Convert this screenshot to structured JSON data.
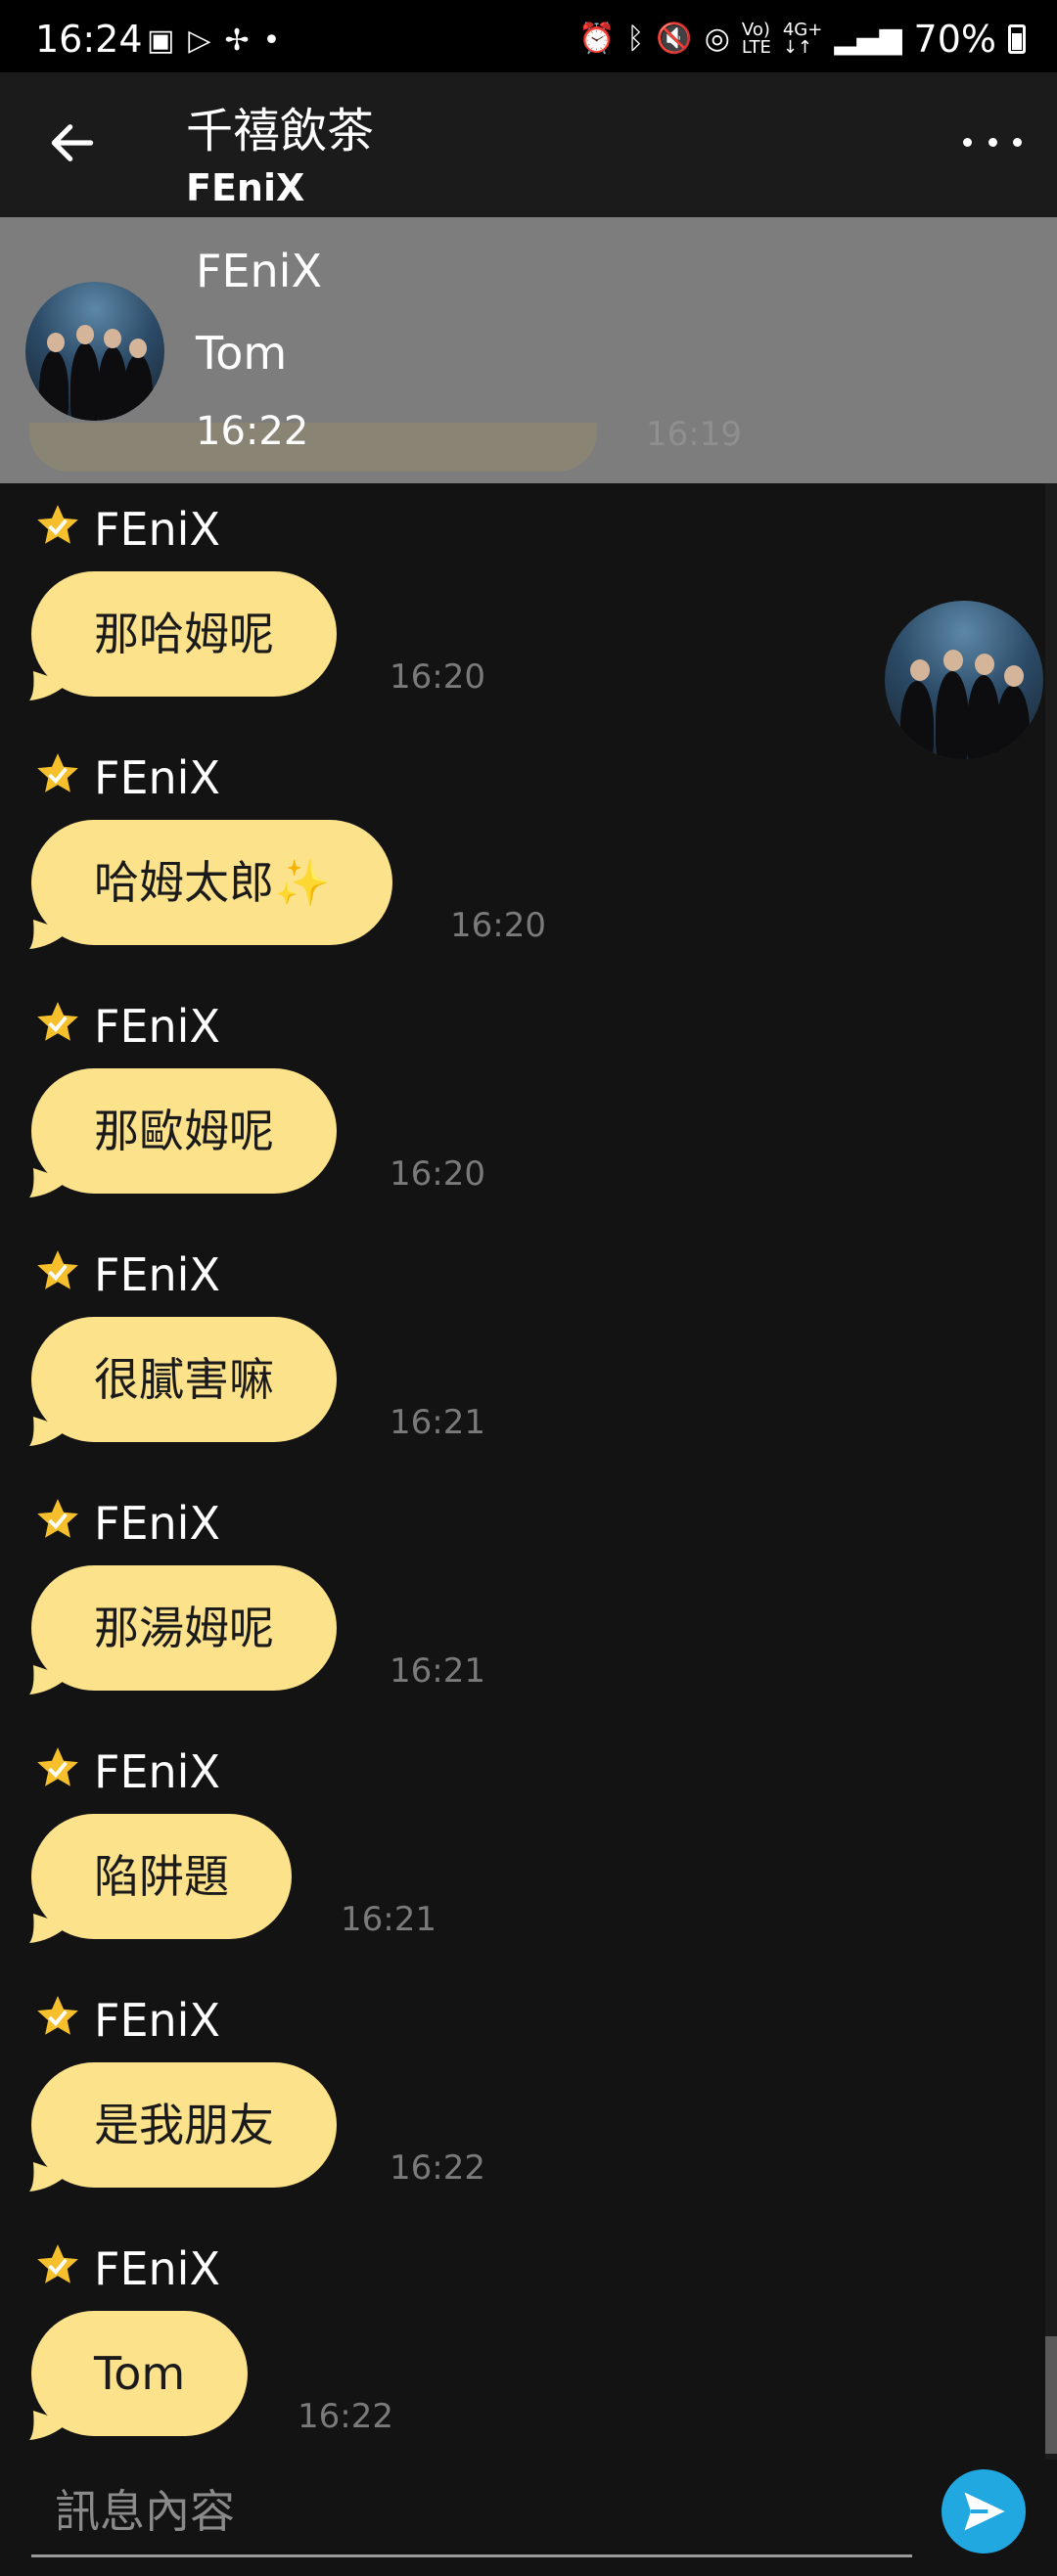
{
  "status_bar": {
    "time": "16:24",
    "battery": "70%",
    "left_icons": [
      "gallery-icon",
      "play-store-icon",
      "fan-icon",
      "dot-icon"
    ],
    "right_icons": [
      "alarm-icon",
      "bluetooth-icon",
      "mute-icon",
      "hotspot-icon",
      "volte-icon",
      "4g-icon",
      "signal-icon",
      "battery-icon"
    ]
  },
  "header": {
    "title": "千禧飲茶",
    "subtitle": "FEniX"
  },
  "notification": {
    "sender": "FEniX",
    "message": "Tom",
    "time": "16:22",
    "hidden_time": "16:19"
  },
  "messages": [
    {
      "sender": "FEniX",
      "text": "那哈姆呢",
      "time": "16:20"
    },
    {
      "sender": "FEniX",
      "text": "哈姆太郎✨",
      "time": "16:20"
    },
    {
      "sender": "FEniX",
      "text": "那歐姆呢",
      "time": "16:20"
    },
    {
      "sender": "FEniX",
      "text": "很膩害嘛",
      "time": "16:21"
    },
    {
      "sender": "FEniX",
      "text": "那湯姆呢",
      "time": "16:21"
    },
    {
      "sender": "FEniX",
      "text": "陷阱題",
      "time": "16:21"
    },
    {
      "sender": "FEniX",
      "text": "是我朋友",
      "time": "16:22"
    },
    {
      "sender": "FEniX",
      "text": "Tom",
      "time": "16:22"
    }
  ],
  "composer": {
    "placeholder": "訊息內容"
  },
  "colors": {
    "bubble": "#fde28c",
    "background": "#131313",
    "send": "#22a8e0",
    "star": "#f5c02b"
  }
}
